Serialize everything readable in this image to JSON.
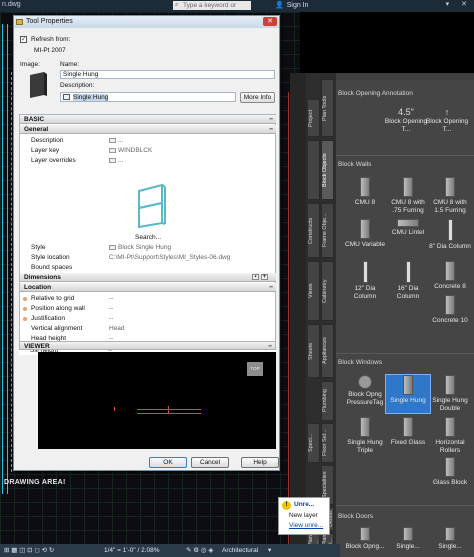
{
  "app": {
    "doc_tab": "n.dwg",
    "search_placeholder": "Type a keyword or phrase",
    "sign_in": "Sign In",
    "drawing_area_label": "DRAWING AREA!"
  },
  "dialog": {
    "title": "Tool Properties",
    "close_label": "✕",
    "refresh_label": "Refresh from:",
    "refresh_source": "MI-Pt 2007",
    "image_label": "Image:",
    "name_label": "Name:",
    "name_value": "Single Hung",
    "description_label": "Description:",
    "description_value": "Single Hung",
    "more_info": "More Info",
    "sections": {
      "basic": "BASIC",
      "general": "General",
      "dimensions": "Dimensions",
      "location": "Location",
      "viewer": "VIEWER"
    },
    "general_rows": [
      {
        "key": "Description",
        "value": "..."
      },
      {
        "key": "Layer key",
        "value": "WINDBLCK"
      },
      {
        "key": "Layer overrides",
        "value": "..."
      }
    ],
    "search_link": "Search...",
    "general_rows_2": [
      {
        "key": "Style",
        "value": "Block Single Hung"
      },
      {
        "key": "Style location",
        "value": "C:\\MI-Pt\\Support\\Styles\\MI_Styles-06.dwg"
      },
      {
        "key": "Bound spaces",
        "value": ""
      }
    ],
    "location_rows": [
      {
        "key": "Relative to grid",
        "value": "--"
      },
      {
        "key": "Position along wall",
        "value": "--"
      },
      {
        "key": "Justification",
        "value": "--"
      },
      {
        "key": "Vertical alignment",
        "value": "Head"
      },
      {
        "key": "Head height",
        "value": "--"
      },
      {
        "key": "Sill height",
        "value": "--"
      }
    ],
    "viewer_top": "TOP",
    "buttons": {
      "ok": "OK",
      "cancel": "Cancel",
      "help": "Help"
    }
  },
  "palette": {
    "tabs": [
      "Project",
      "Plan Tools",
      "Block Objects",
      "Constructs",
      "Frame Obje...",
      "Views",
      "Cabinetry",
      "Sheets",
      "Appliances",
      "Plumbing",
      "Floor Sel...",
      "Speci...",
      "Specialties",
      "Plan Details",
      "GF-Plan Reli...",
      "Tol-Plan Ri..."
    ],
    "groups": {
      "opening": "Block Opening Annotation",
      "walls": "Block Walls",
      "windows": "Block Windows",
      "doors": "Block Doors"
    },
    "opening_items": [
      {
        "label": "Block Opening T...",
        "glyph": "4.5\""
      },
      {
        "label": "Block Opening T...",
        "glyph": "↑"
      }
    ],
    "wall_items": [
      "CMU 8",
      "CMU 8 with .75 Furring",
      "CMU 8 with 1.5 Furring",
      "CMU Variable",
      "CMU Lintel",
      "8\" Dia Column",
      "12\" Dia Column",
      "16\" Dia Column",
      "Concrete 8",
      "Concrete 10"
    ],
    "window_items": [
      "Block Opng PressureTag",
      "Single Hung",
      "Single Hung Double",
      "Single Hung Triple",
      "Fixed Glass",
      "Horizontal Rollers",
      "Glass Block"
    ],
    "door_items": [
      "Block Opng...",
      "Single...",
      "Single..."
    ]
  },
  "notification": {
    "title": "Unre...",
    "line1": "New layer",
    "link": "View unre..."
  },
  "statusbar": {
    "scale": "1/4\" = 1'-0\" / 2.08%",
    "workspace": "Architectural"
  }
}
